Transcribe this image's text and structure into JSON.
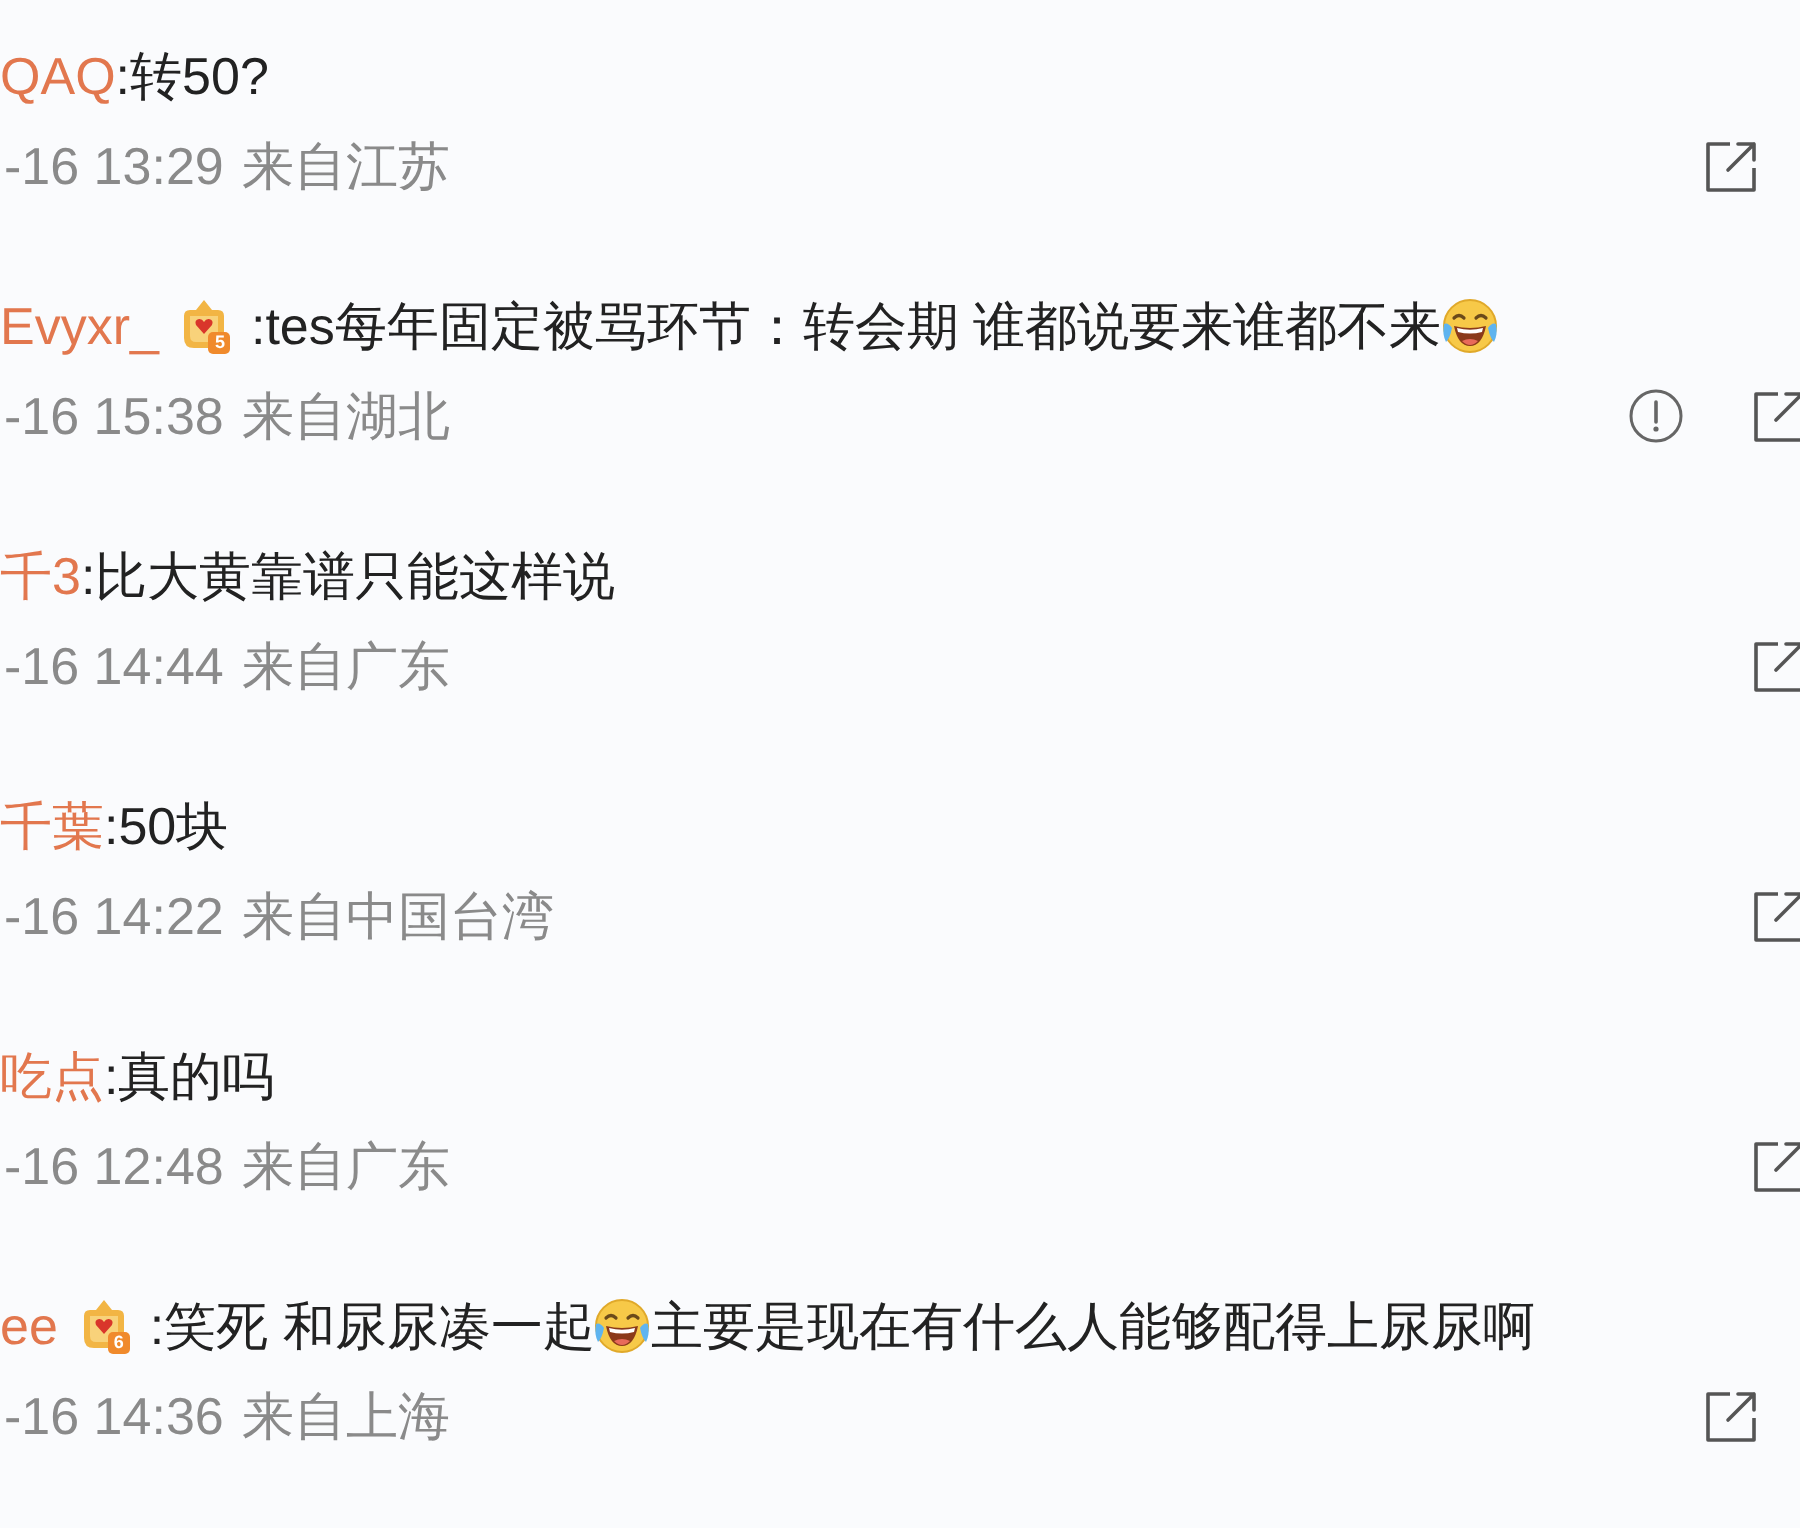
{
  "comments": [
    {
      "username": "QAQ",
      "content": [
        {
          "kind": "text",
          "text": ":转50?"
        }
      ],
      "time": "-16 13:29",
      "location": "来自江苏",
      "report_button": false,
      "actions_at_edge": false
    },
    {
      "username": "Evyxr_",
      "badge": "5",
      "content": [
        {
          "kind": "text",
          "text": ":tes每年固定被骂环节：转会期 谁都说要来谁都不来"
        },
        {
          "kind": "emoji"
        }
      ],
      "time": "-16 15:38",
      "location": "来自湖北",
      "report_button": true,
      "actions_at_edge": true
    },
    {
      "username": "千3",
      "content": [
        {
          "kind": "text",
          "text": ":比大黄靠谱只能这样说"
        }
      ],
      "time": "-16 14:44",
      "location": "来自广东",
      "report_button": false,
      "actions_at_edge": true
    },
    {
      "username": "千葉",
      "content": [
        {
          "kind": "text",
          "text": ":50块"
        }
      ],
      "time": "-16 14:22",
      "location": "来自中国台湾",
      "report_button": false,
      "actions_at_edge": true
    },
    {
      "username": "吃点",
      "content": [
        {
          "kind": "text",
          "text": ":真的吗"
        }
      ],
      "time": "-16 12:48",
      "location": "来自广东",
      "report_button": false,
      "actions_at_edge": true
    },
    {
      "username": "ee",
      "badge": "6",
      "content": [
        {
          "kind": "text",
          "text": ":笑死 和尿尿凑一起"
        },
        {
          "kind": "emoji"
        },
        {
          "kind": "text",
          "text": "主要是现在有什么人能够配得上尿尿啊"
        }
      ],
      "time": "-16 14:36",
      "location": "来自上海",
      "report_button": false,
      "actions_at_edge": false
    }
  ]
}
